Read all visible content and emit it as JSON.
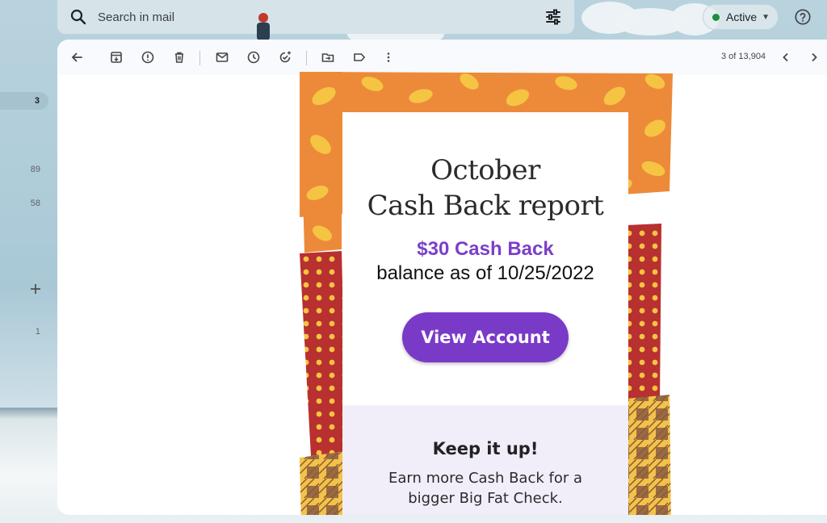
{
  "search": {
    "placeholder": "Search in mail"
  },
  "status": {
    "label": "Active"
  },
  "rail": {
    "badge": "3",
    "counts": [
      "89",
      "58",
      "1"
    ]
  },
  "toolbar": {
    "pagination": "3 of 13,904"
  },
  "email": {
    "title_line1": "October",
    "title_line2": "Cash Back report",
    "cash_back": "$30 Cash Back",
    "balance": "balance as of 10/25/2022",
    "cta_label": "View Account",
    "keep_title": "Keep it up!",
    "keep_body_line1": "Earn more Cash Back for a",
    "keep_body_line2": "bigger Big Fat Check."
  },
  "colors": {
    "accent_purple": "#7a3ac8",
    "status_green": "#1e8e3e",
    "leaf_orange": "#ec8a3a",
    "leaf_yellow": "#f5c443",
    "dots_red": "#b8302f",
    "plaid_brown": "#9a6b43"
  }
}
